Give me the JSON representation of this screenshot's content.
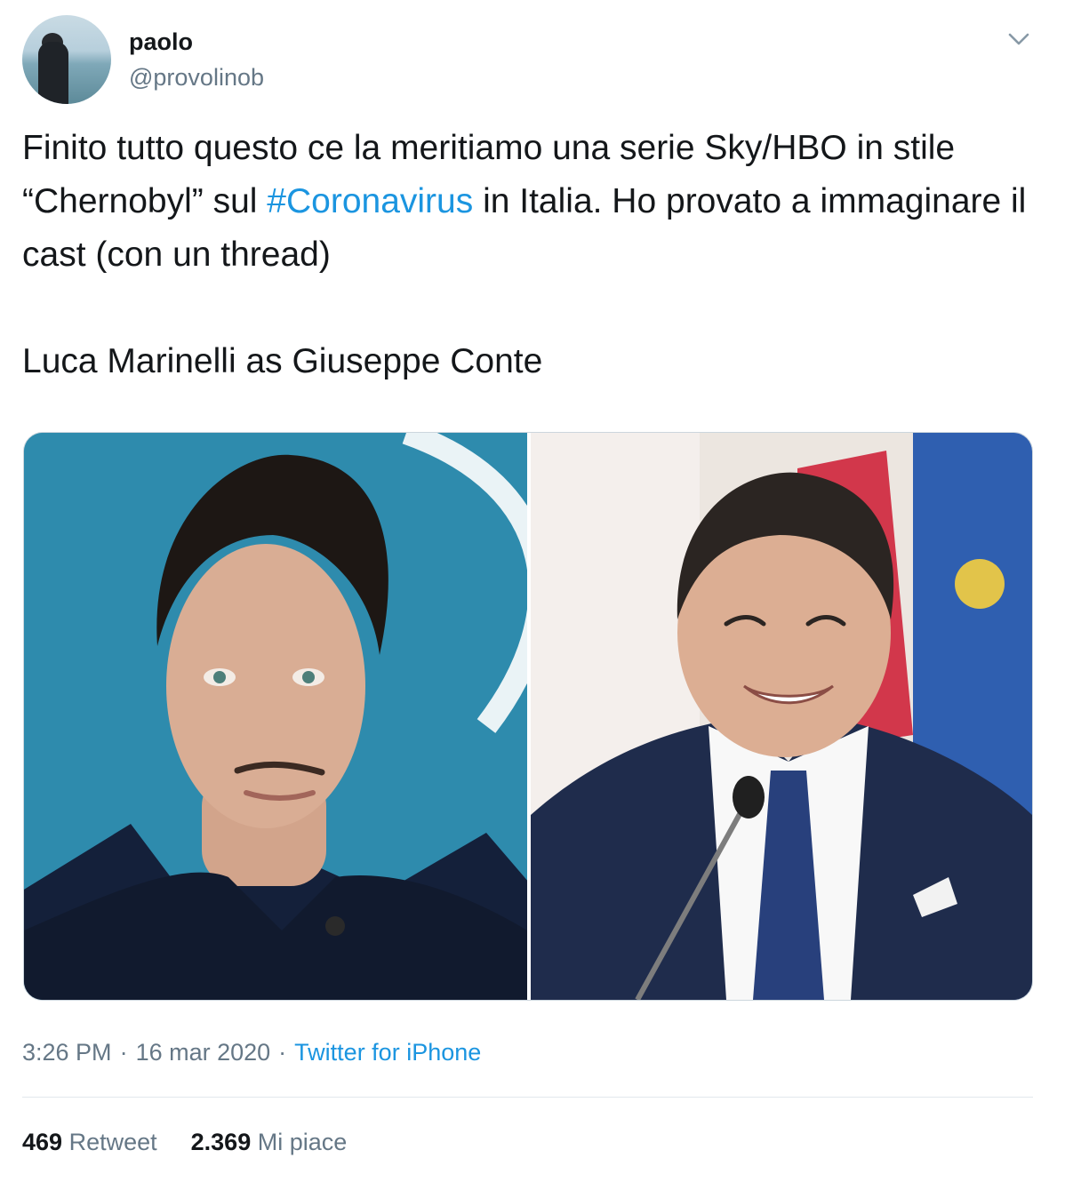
{
  "author": {
    "name": "paolo",
    "handle": "@provolinob"
  },
  "icons": {
    "more": "chevron-down-icon"
  },
  "tweet": {
    "text_before_hashtag": "Finito tutto questo ce la meritiamo una serie Sky/HBO in stile “Chernobyl” sul ",
    "hashtag": "#Coronavirus",
    "text_after_hashtag": " in Italia. Ho provato a immaginare il cast (con un thread)",
    "second_paragraph": "Luca Marinelli as Giuseppe Conte"
  },
  "media": {
    "count": 2
  },
  "meta": {
    "time": "3:26 PM",
    "separator": "·",
    "date": "16 mar 2020",
    "source": "Twitter for iPhone"
  },
  "stats": {
    "retweets_count": "469",
    "retweets_label": "Retweet",
    "likes_count": "2.369",
    "likes_label": "Mi piace"
  },
  "colors": {
    "link": "#1b95e0",
    "secondary_text": "#657786",
    "primary_text": "#14171a",
    "divider": "#e1e8ed"
  }
}
